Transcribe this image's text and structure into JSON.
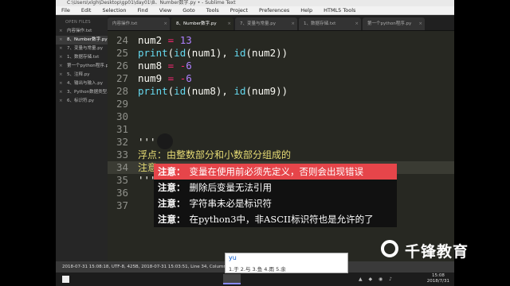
{
  "window": {
    "title": "C:\\Users\\xlgh\\Desktop\\gp01\\day01\\8、Number数字.py • - Sublime Text"
  },
  "menu": [
    "File",
    "Edit",
    "Selection",
    "Find",
    "View",
    "Goto",
    "Tools",
    "Project",
    "Preferences",
    "Help",
    "HTML5 Tools"
  ],
  "sidebar": {
    "header": "OPEN FILES",
    "items": [
      {
        "label": "内容操作.txt",
        "active": false
      },
      {
        "label": "8、Number数字.py",
        "active": true
      },
      {
        "label": "7、变量与常量.py",
        "active": false
      },
      {
        "label": "1、数据存储.txt",
        "active": false
      },
      {
        "label": "第一个python程序.py",
        "active": false
      },
      {
        "label": "5、注释.py",
        "active": false
      },
      {
        "label": "4、输出与输入.py",
        "active": false
      },
      {
        "label": "3、Python数据类型.txt",
        "active": false
      },
      {
        "label": "6、标识符.py",
        "active": false
      }
    ]
  },
  "tabs": [
    {
      "label": "内容操作.txt",
      "active": false
    },
    {
      "label": "8、Number数字.py",
      "active": true
    },
    {
      "label": "7、变量与常量.py",
      "active": false
    },
    {
      "label": "1、数据存储.txt",
      "active": false
    },
    {
      "label": "第一个python程序.py",
      "active": false
    }
  ],
  "editor": {
    "lines": [
      {
        "n": "24",
        "text": "num2 = 13"
      },
      {
        "n": "25",
        "text": "print(id(num1), id(num2))"
      },
      {
        "n": "26",
        "text": "num8 = -6"
      },
      {
        "n": "27",
        "text": "num9 = -6"
      },
      {
        "n": "28",
        "text": "print(id(num8), id(num9))"
      },
      {
        "n": "29",
        "text": ""
      },
      {
        "n": "30",
        "text": ""
      },
      {
        "n": "31",
        "text": ""
      },
      {
        "n": "32",
        "text": "'''"
      },
      {
        "n": "33",
        "text": "浮点：由整数部分和小数部分组成的"
      },
      {
        "n": "34",
        "text": "注意："
      },
      {
        "n": "35",
        "text": "'''"
      },
      {
        "n": "36",
        "text": ""
      },
      {
        "n": "37",
        "text": ""
      }
    ]
  },
  "notes": [
    {
      "label": "注意：",
      "text": "变量在使用前必须先定义，否则会出现错误"
    },
    {
      "label": "注意：",
      "text": "删除后变量无法引用"
    },
    {
      "label": "注意：",
      "text": "字符串未必是标识符"
    },
    {
      "label": "注意：",
      "text": "在python3中，非ASCII标识符也是允许的了"
    }
  ],
  "statusbar": {
    "text": "2018-07-31 15:08:18, UTF-8, 425B, 2018-07-31 15:03:51, Line 34, Column 8"
  },
  "ime": {
    "input": "yu",
    "candidates": "1.于  2.与  3.鱼  4.雨  5.余"
  },
  "taskbar": {
    "time": "15:08",
    "date": "2018/7/31"
  },
  "logo": {
    "text": "千锋教育"
  }
}
